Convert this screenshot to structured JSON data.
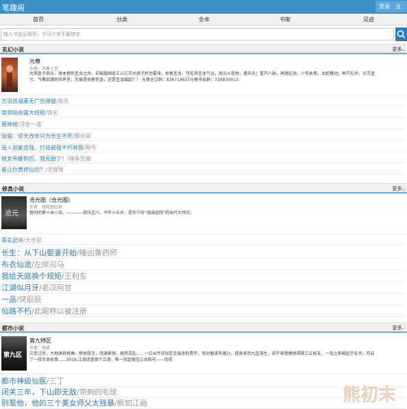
{
  "header": {
    "title": "笔趣阁",
    "login_label": "登录",
    "register_label": "注册"
  },
  "nav": {
    "items": [
      "首页",
      "分类",
      "全本",
      "书架",
      "足迹"
    ]
  },
  "search": {
    "placeholder": "输入书名后搜索，宁可少字不要错字"
  },
  "sections": [
    {
      "title": "玄幻小说",
      "more": "更多..",
      "featured": {
        "title": "元尊",
        "author": "作者：天蚕土豆",
        "desc_line1": "大周皇子周元，原本拥有圣龙之命，却被敌国武王以亿万大周子民为要挟，掠者圣龙，夺走其圣龙气运。周元入祖地，遇夭夭；重开八脉，再踏征途。少年执笔，龙蛇舞动；再开乱世，点灵皇",
        "desc_line2": "兮。气聚如诸的世界里，究竟是掠者苍龙，还是圣龙崛起？！ 元尊全订群：836714637元尊书友群：729830913"
      },
      "items": [
        {
          "title": "方羽苏凝素无广告弹窗",
          "author": "/佚名"
        },
        {
          "title": "简思陆佑霆大结局",
          "author": "/佚名"
        },
        {
          "title": "葬神棺",
          "author": "/浮生一诺"
        },
        {
          "title": "穿越：逆天改命只为长生不死",
          "author": "/醒丝哥"
        },
        {
          "title": "造人就能变强，打造最强不朽神族",
          "author": "/新号"
        },
        {
          "title": "被女帝推倒后，我无敌了！",
          "author": "/辣鱼豆腐"
        },
        {
          "title": "谁让你真修仙的？",
          "author": "/泼猴猴"
        }
      ]
    },
    {
      "title": "修真小说",
      "more": "更多..",
      "featured": {
        "title": "沧元图（仓元图）",
        "author": "作者：我吃西红柿",
        "desc_line1": "普同的第十本小说。————我叫孟川，今年十五岁，是东宁府“镜湖道院”的当代大师兄。",
        "desc_line2": ""
      },
      "items": [
        {
          "title": "青玄武帝",
          "author": "/大仓鼠"
        },
        {
          "title": "长生：从下山娶妻开始",
          "author": "/睡凶黄药师"
        },
        {
          "title": "布衣仙途",
          "author": "/左岸司马"
        },
        {
          "title": "我给天庭换个规矩",
          "author": "/王利东"
        },
        {
          "title": "江湖似月牙",
          "author": "/老汉阿甘"
        },
        {
          "title": "一品",
          "author": "/突辰辰"
        },
        {
          "title": "仙路不朽",
          "author": "/此昵称以被注册"
        }
      ]
    },
    {
      "title": "都市小说",
      "more": "更多..",
      "featured": {
        "title": "第九特区",
        "author": "作者：伪戒",
        "desc_line1": "灾变过后，大地满目疮痍。粮食匮乏，资源紧俏，局势混乱......一位从传说狱区走出来的青年，背对着漫天黄沙，孤身来到九区谋生，却不曾想偶然得罪三五好友，一念之差崛起于乱世，开启",
        "desc_line2": "了一段传奇故事......2019,江湖还是那个江湖，唯一指定微信公共账号——伪戒"
      },
      "items": [
        {
          "title": "都市神级仙医",
          "author": "/三丁"
        },
        {
          "title": "闭关三年，下山即无敌",
          "author": "/带刺的毛球"
        },
        {
          "title": "别惹他，他的三个美女师父太残暴",
          "author": "/枫如江画"
        }
      ]
    }
  ],
  "watermark": "熊初末",
  "colors": {
    "accent": "#3a8fc7",
    "link": "#2d7ec0"
  }
}
